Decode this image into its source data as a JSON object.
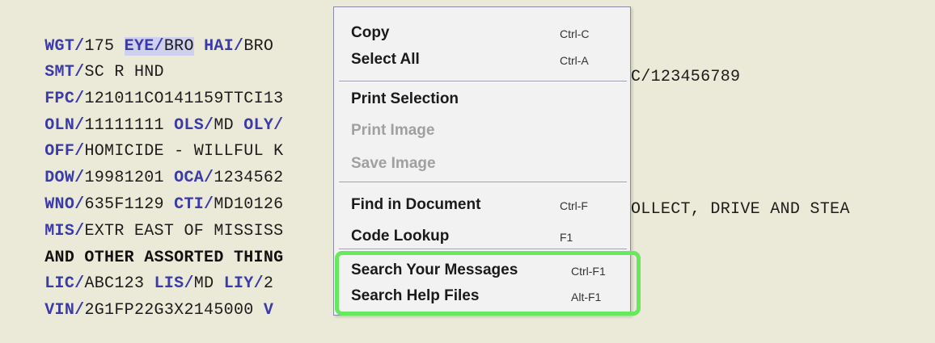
{
  "document": {
    "lines": [
      {
        "segments": [
          {
            "text": "WGT/",
            "style": "tag"
          },
          {
            "text": "175 ",
            "style": "plain"
          },
          {
            "text": "EYE/",
            "style": "tag-sel"
          },
          {
            "text": "BRO",
            "style": "sel"
          },
          {
            "text": " ",
            "style": "plain"
          },
          {
            "text": "HAI/",
            "style": "tag"
          },
          {
            "text": "BRO",
            "style": "plain"
          }
        ]
      },
      {
        "segments": [
          {
            "text": "SMT/",
            "style": "tag"
          },
          {
            "text": "SC R HND",
            "style": "plain"
          }
        ]
      },
      {
        "segments": [
          {
            "text": "FPC/",
            "style": "tag"
          },
          {
            "text": "121011CO141159TTCI13",
            "style": "plain"
          }
        ],
        "right": "C/123456789"
      },
      {
        "segments": [
          {
            "text": "OLN/",
            "style": "tag"
          },
          {
            "text": "11111111 ",
            "style": "plain"
          },
          {
            "text": "OLS/",
            "style": "tag"
          },
          {
            "text": "MD ",
            "style": "plain"
          },
          {
            "text": "OLY/",
            "style": "tag"
          }
        ]
      },
      {
        "segments": [
          {
            "text": "OFF/",
            "style": "tag"
          },
          {
            "text": "HOMICIDE - WILLFUL K",
            "style": "plain"
          }
        ]
      },
      {
        "segments": [
          {
            "text": "DOW/",
            "style": "tag"
          },
          {
            "text": "19981201 ",
            "style": "plain"
          },
          {
            "text": "OCA/",
            "style": "tag"
          },
          {
            "text": "1234562",
            "style": "plain"
          }
        ]
      },
      {
        "segments": [
          {
            "text": "WNO/",
            "style": "tag"
          },
          {
            "text": "635F1129 ",
            "style": "plain"
          },
          {
            "text": "CTI/",
            "style": "tag"
          },
          {
            "text": "MD10126",
            "style": "plain"
          }
        ]
      },
      {
        "segments": [
          {
            "text": "MIS/",
            "style": "tag"
          },
          {
            "text": "EXTR EAST OF MISSISS",
            "style": "plain"
          }
        ],
        "right": "OLLECT, DRIVE AND STEA"
      },
      {
        "segments": [
          {
            "text": "AND OTHER ASSORTED THING",
            "style": "bold"
          }
        ]
      },
      {
        "segments": [
          {
            "text": "LIC/",
            "style": "tag"
          },
          {
            "text": "ABC123 ",
            "style": "plain"
          },
          {
            "text": "LIS/",
            "style": "tag"
          },
          {
            "text": "MD ",
            "style": "plain"
          },
          {
            "text": "LIY/",
            "style": "tag"
          },
          {
            "text": "2",
            "style": "plain"
          }
        ]
      },
      {
        "segments": [
          {
            "text": "VIN/",
            "style": "tag"
          },
          {
            "text": "2G1FP22G3X2145000 ",
            "style": "plain"
          },
          {
            "text": "V",
            "style": "tag"
          }
        ]
      }
    ]
  },
  "context_menu": {
    "items": [
      {
        "label": "Copy",
        "shortcut": "Ctrl-C",
        "enabled": true
      },
      {
        "label": "Select All",
        "shortcut": "Ctrl-A",
        "enabled": true
      },
      {
        "label": "Print Selection",
        "shortcut": "",
        "enabled": true
      },
      {
        "label": "Print Image",
        "shortcut": "",
        "enabled": false
      },
      {
        "label": "Save Image",
        "shortcut": "",
        "enabled": false
      },
      {
        "label": "Find in Document",
        "shortcut": "Ctrl-F",
        "enabled": true
      },
      {
        "label": "Code Lookup",
        "shortcut": "F1",
        "enabled": true
      },
      {
        "label": "Search Your Messages",
        "shortcut": "Ctrl-F1",
        "enabled": true
      },
      {
        "label": "Search Help Files",
        "shortcut": "Alt-F1",
        "enabled": true
      }
    ]
  },
  "colors": {
    "background": "#ebe9d7",
    "tag": "#3a3aa8",
    "selection": "#cfd0ee",
    "highlight_box": "#66e95c",
    "disabled_text": "#a0a0a0"
  }
}
